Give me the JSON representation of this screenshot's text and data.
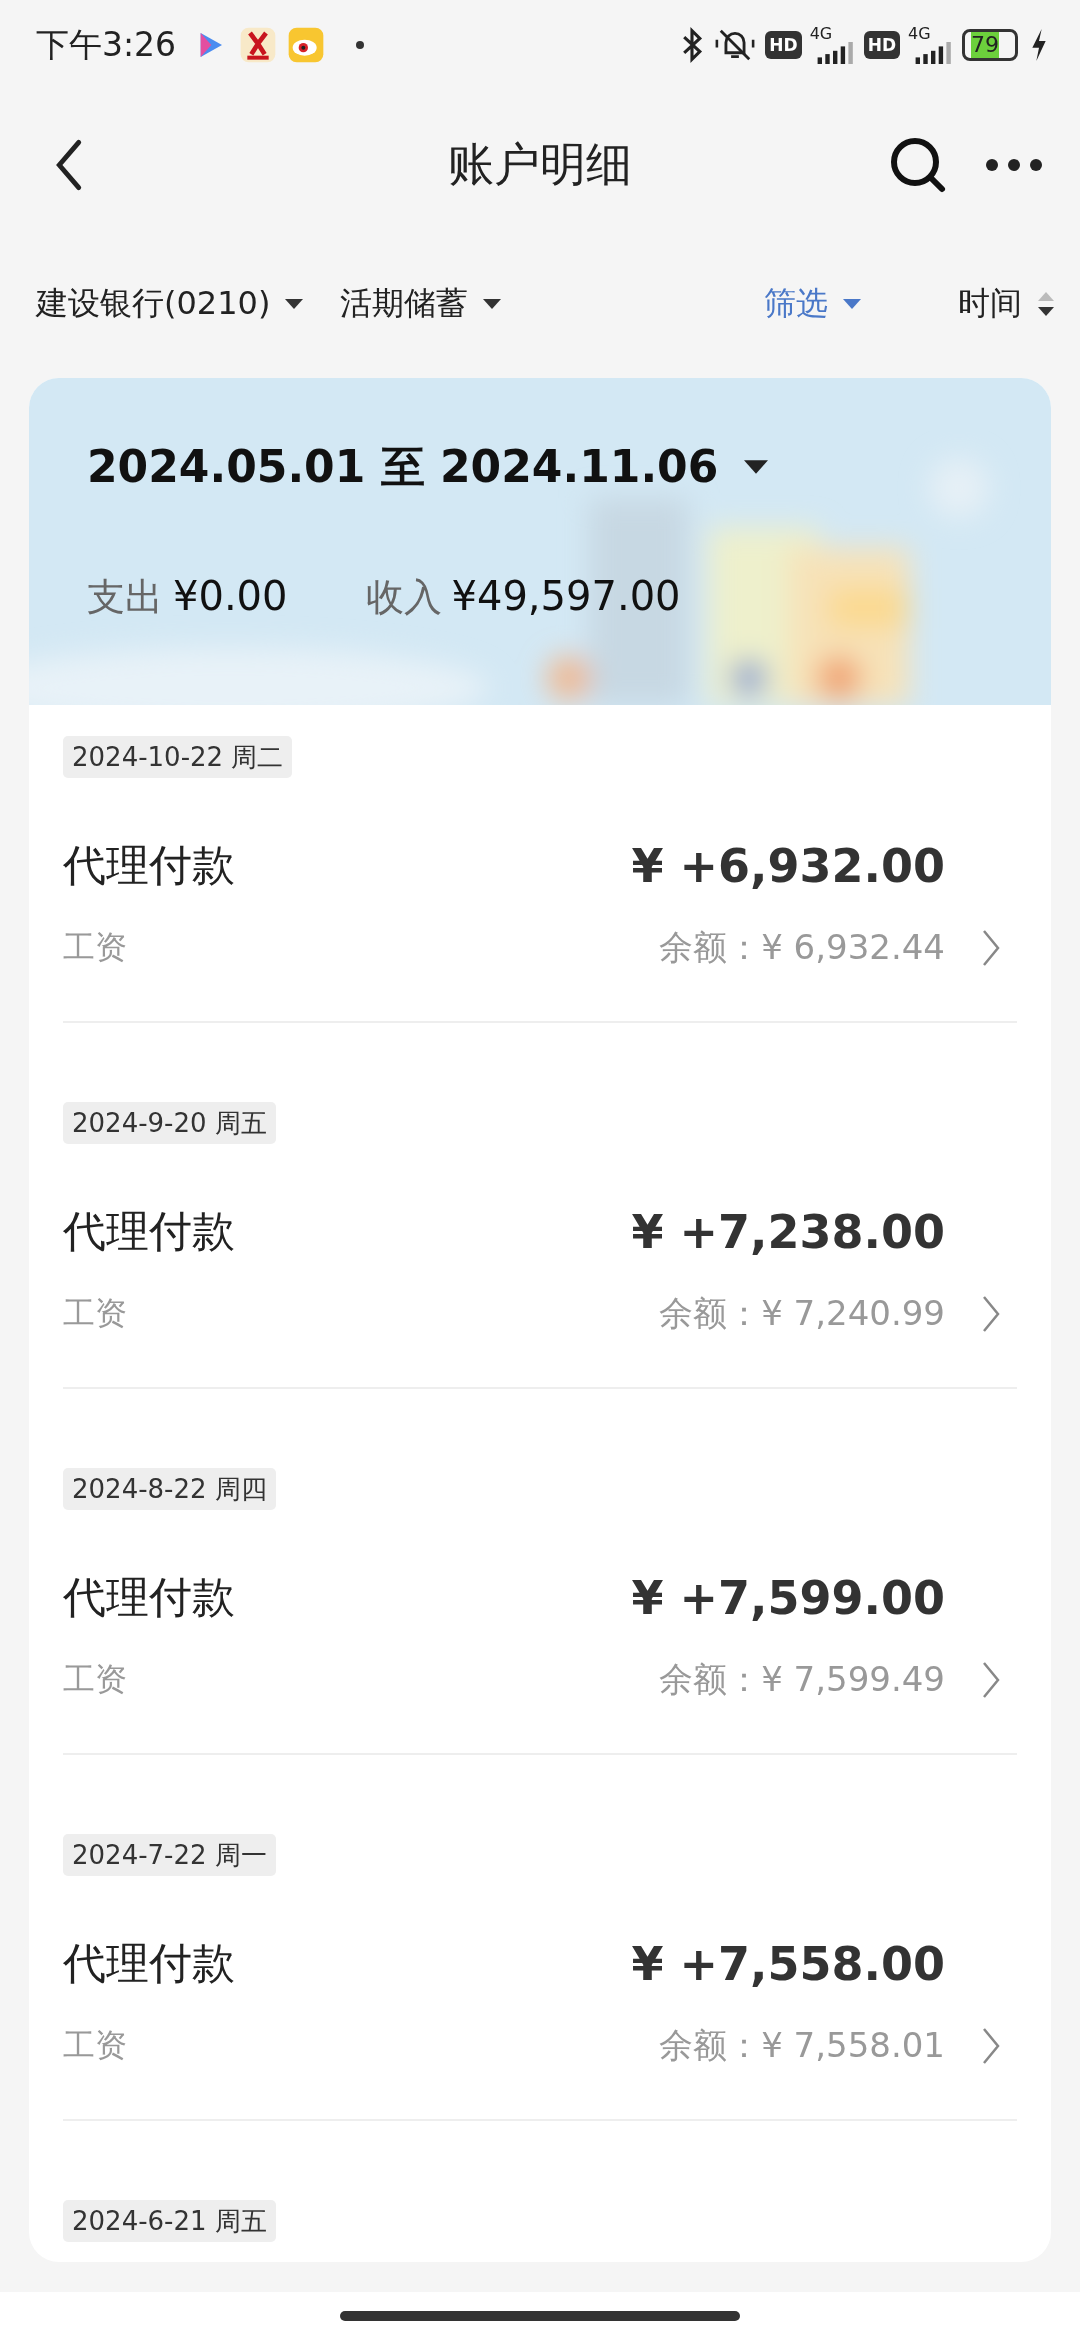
{
  "status_bar": {
    "time": "下午3:26",
    "sim_badges": [
      "HD",
      "HD"
    ],
    "network_labels": [
      "4G",
      "4G"
    ],
    "battery": "79"
  },
  "header": {
    "title": "账户明细"
  },
  "filters": [
    {
      "label": "建设银行(0210)",
      "kind": "dropdown",
      "active": false
    },
    {
      "label": "活期储蓄",
      "kind": "dropdown",
      "active": false
    },
    {
      "label": "筛选",
      "kind": "dropdown",
      "active": true
    },
    {
      "label": "时间",
      "kind": "sort",
      "active": false
    }
  ],
  "summary": {
    "date_from": "2024.05.01",
    "date_sep": "至",
    "date_to": "2024.11.06",
    "expense_label": "支出",
    "expense": "¥0.00",
    "income_label": "收入",
    "income": "¥49,597.00"
  },
  "groups": [
    {
      "date": "2024-10-22 周二",
      "entry": {
        "title": "代理付款",
        "note": "工资",
        "amount": "¥ +6,932.00",
        "balance": "余额：¥ 6,932.44"
      }
    },
    {
      "date": "2024-9-20 周五",
      "entry": {
        "title": "代理付款",
        "note": "工资",
        "amount": "¥ +7,238.00",
        "balance": "余额：¥ 7,240.99"
      }
    },
    {
      "date": "2024-8-22 周四",
      "entry": {
        "title": "代理付款",
        "note": "工资",
        "amount": "¥ +7,599.00",
        "balance": "余额：¥ 7,599.49"
      }
    },
    {
      "date": "2024-7-22 周一",
      "entry": {
        "title": "代理付款",
        "note": "工资",
        "amount": "¥ +7,558.00",
        "balance": "余额：¥ 7,558.01"
      }
    },
    {
      "date": "2024-6-21 周五"
    }
  ]
}
